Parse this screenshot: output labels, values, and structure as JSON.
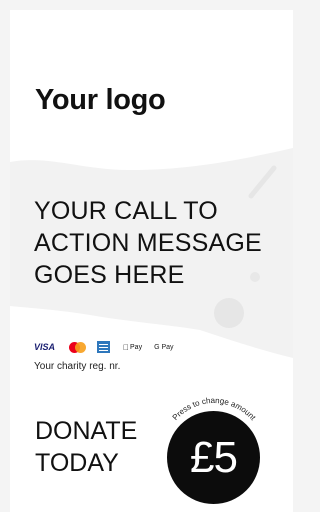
{
  "logo": {
    "text": "Your logo"
  },
  "cta": {
    "lines": [
      "YOUR CALL TO",
      "ACTION MESSAGE",
      "GOES HERE"
    ]
  },
  "payments": {
    "visa": "VISA",
    "mastercard": "mastercard-icon",
    "amex": "amex-icon",
    "apple_pay": "Pay",
    "google_pay": "G Pay"
  },
  "charity": {
    "reg_text": "Your charity reg. nr."
  },
  "donate": {
    "lines": [
      "DONATE",
      "TODAY"
    ]
  },
  "amount": {
    "value": "£5",
    "hint": "Press to change amount"
  },
  "colors": {
    "background": "#ffffff",
    "button": "#0c0c0c",
    "wave": "#f2f2f2"
  }
}
